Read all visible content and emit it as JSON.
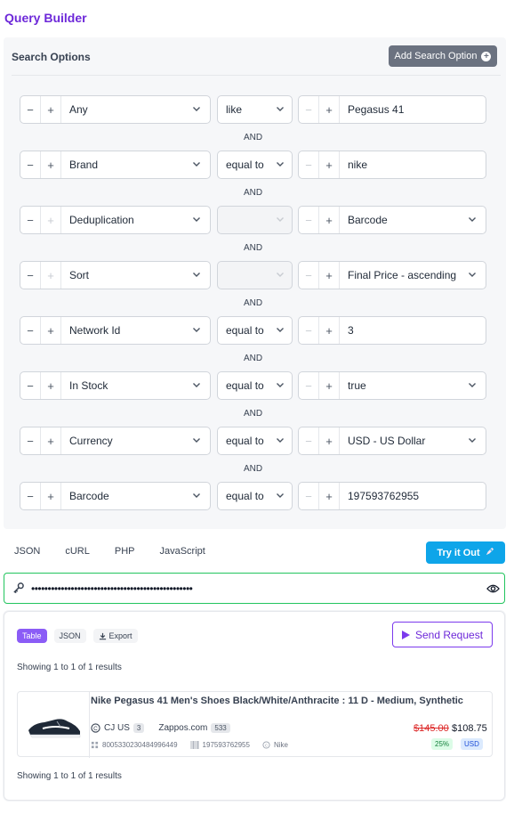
{
  "title": "Query Builder",
  "search_options": {
    "header": "Search Options",
    "add_button": "Add Search Option",
    "joiner": "AND",
    "rows": [
      {
        "field": "Any",
        "operator": "like",
        "value": "Pegasus 41",
        "value_type": "text"
      },
      {
        "field": "Brand",
        "operator": "equal to",
        "value": "nike",
        "value_type": "text"
      },
      {
        "field": "Deduplication",
        "operator": "",
        "value": "Barcode",
        "value_type": "select"
      },
      {
        "field": "Sort",
        "operator": "",
        "value": "Final Price - ascending",
        "value_type": "select"
      },
      {
        "field": "Network Id",
        "operator": "equal to",
        "value": "3",
        "value_type": "text"
      },
      {
        "field": "In Stock",
        "operator": "equal to",
        "value": "true",
        "value_type": "select"
      },
      {
        "field": "Currency",
        "operator": "equal to",
        "value": "USD - US Dollar",
        "value_type": "select"
      },
      {
        "field": "Barcode",
        "operator": "equal to",
        "value": "197593762955",
        "value_type": "text"
      }
    ]
  },
  "code_tabs": [
    "JSON",
    "cURL",
    "PHP",
    "JavaScript"
  ],
  "try_button": "Try it Out",
  "api_key": {
    "masked": "•••••••••••••••••••••••••••••••••••••••••••••••••"
  },
  "results": {
    "view_tabs": [
      {
        "label": "Table",
        "active": true
      },
      {
        "label": "JSON",
        "active": false
      },
      {
        "label": "Export",
        "active": false
      }
    ],
    "send_button": "Send Request",
    "showing_text": "Showing 1 to 1 of 1 results",
    "product": {
      "title": "Nike Pegasus 41 Men's Shoes Black/White/Anthracite : 11 D - Medium, Synthetic",
      "network": "CJ US",
      "network_count": "3",
      "merchant": "Zappos.com",
      "merchant_count": "533",
      "id": "8005330230484996449",
      "barcode": "197593762955",
      "brand": "Nike",
      "price_old": "$145.00",
      "price_new": "$108.75",
      "discount": "25%",
      "currency": "USD"
    }
  },
  "colors": {
    "accent": "#6d28d9",
    "try": "#0ea5e9",
    "key_border": "#22c55e"
  }
}
